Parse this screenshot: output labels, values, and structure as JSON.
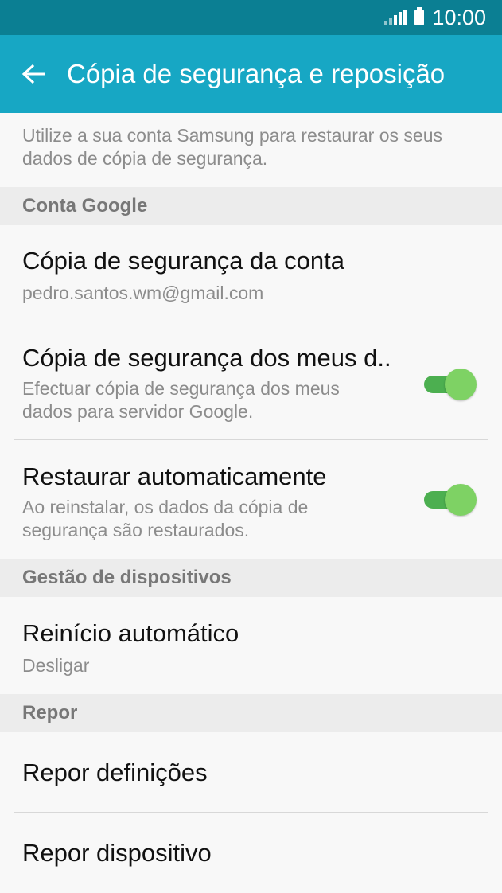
{
  "status_bar": {
    "time": "10:00"
  },
  "app_bar": {
    "title": "Cópia de segurança e reposição"
  },
  "samsung_restore": {
    "description_line1": "Utilize a sua conta Samsung para restaurar os seus",
    "description_line2": "dados de cópia de segurança."
  },
  "sections": {
    "google": "Conta Google",
    "devices": "Gestão de dispositivos",
    "reset": "Repor"
  },
  "items": {
    "backup_account": {
      "title": "Cópia de segurança da conta",
      "subtitle": "pedro.santos.wm@gmail.com"
    },
    "backup_data": {
      "title": "Cópia de segurança dos meus d..",
      "subtitle_line1": "Efectuar cópia de segurança dos meus",
      "subtitle_line2": "dados para servidor Google.",
      "enabled": true
    },
    "auto_restore": {
      "title": "Restaurar automaticamente",
      "subtitle_line1": "Ao reinstalar, os dados da cópia de",
      "subtitle_line2": "segurança são restaurados.",
      "enabled": true
    },
    "auto_restart": {
      "title": "Reinício automático",
      "subtitle": "Desligar"
    },
    "reset_settings": {
      "title": "Repor definições"
    },
    "reset_device": {
      "title": "Repor dispositivo"
    }
  },
  "colors": {
    "status_bar": "#0b7f93",
    "app_bar": "#17a7c4",
    "toggle_on": "#7ed264"
  }
}
